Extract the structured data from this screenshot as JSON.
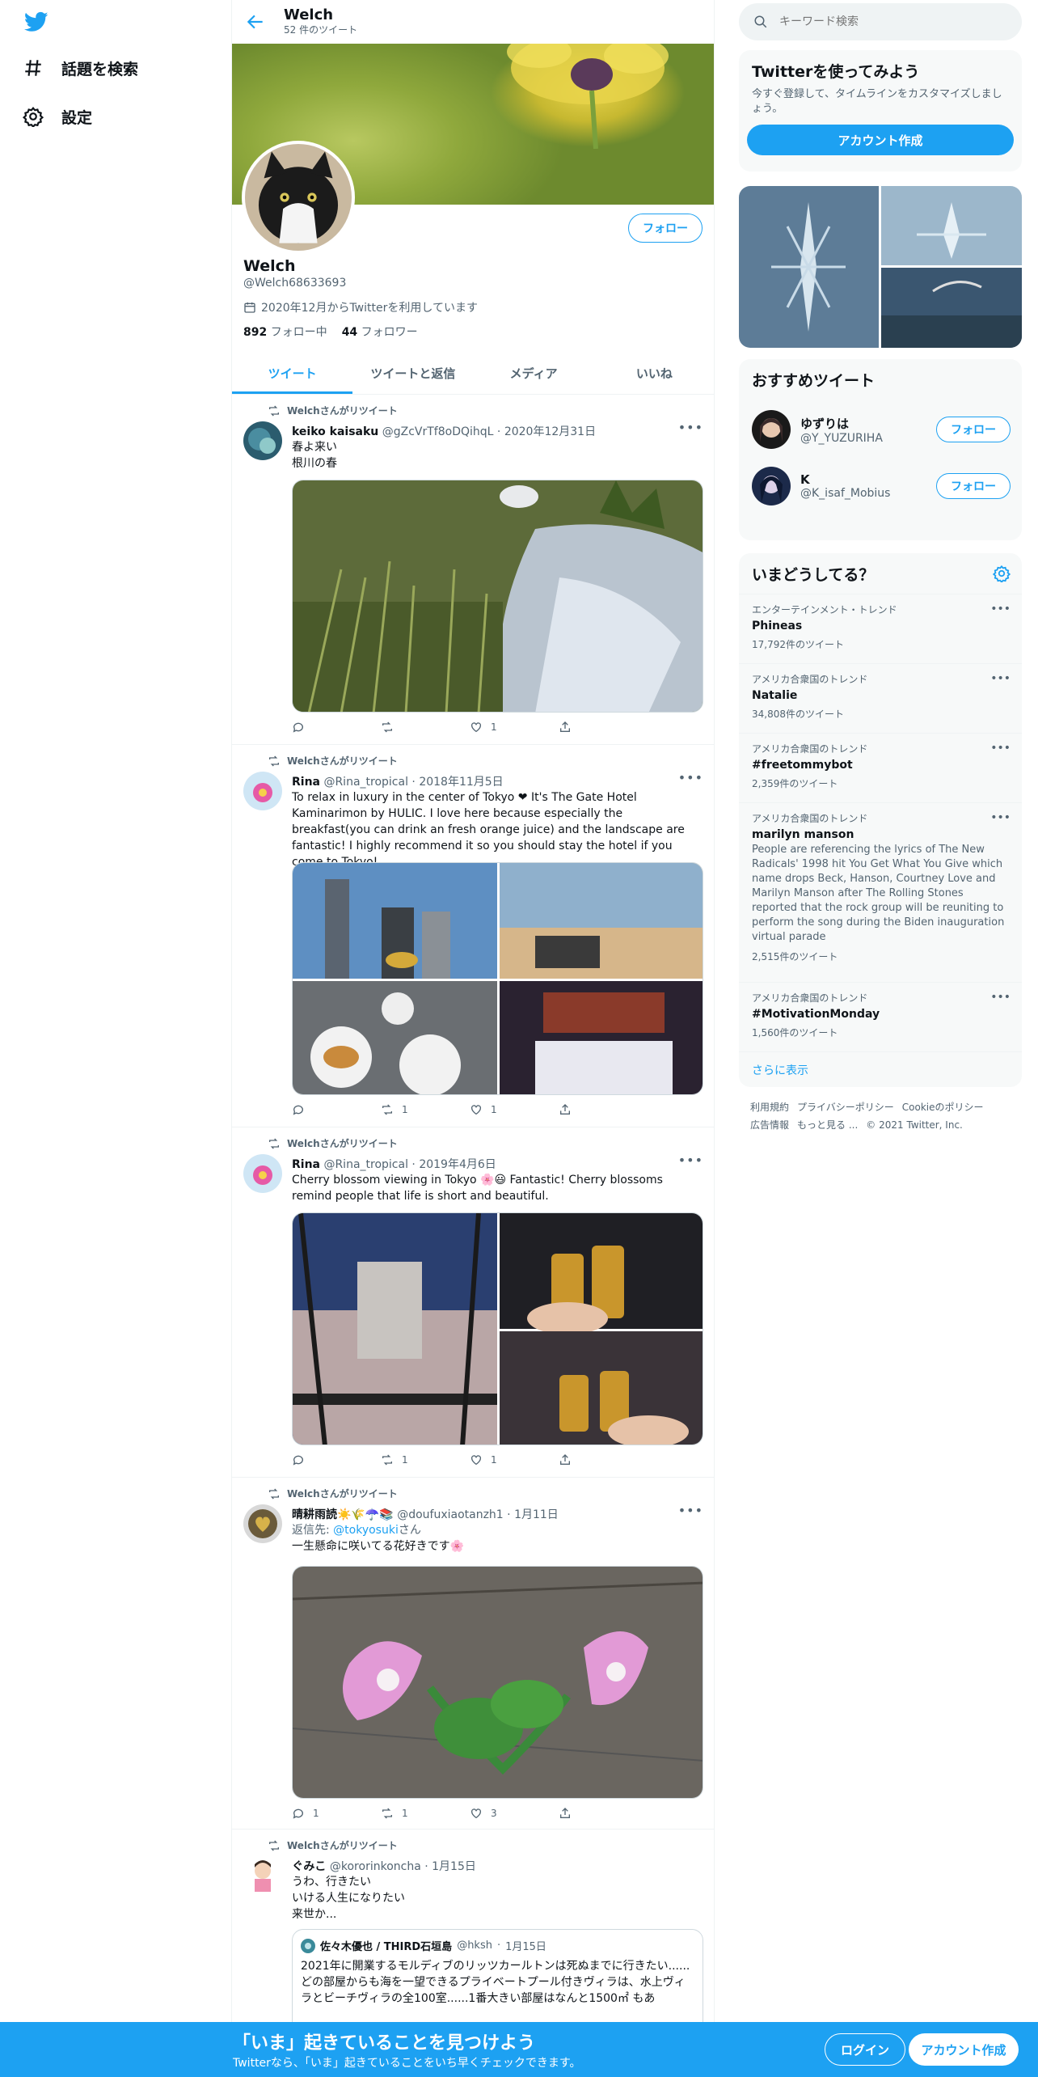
{
  "nav": {
    "explore": "話題を検索",
    "settings": "設定"
  },
  "header": {
    "title": "Welch",
    "tweet_count": "52 件のツイート"
  },
  "profile": {
    "name": "Welch",
    "handle": "@Welch68633693",
    "joined": "2020年12月からTwitterを利用しています",
    "following_num": "892",
    "following_label": "フォロー中",
    "followers_num": "44",
    "followers_label": "フォロワー",
    "follow_label": "フォロー"
  },
  "tabs": [
    "ツイート",
    "ツイートと返信",
    "メディア",
    "いいね"
  ],
  "retweet_label": "Welchさんがリツイート",
  "tweets": [
    {
      "name": "keiko kaisaku",
      "handle": "@gZcVrTf8oDQihqL",
      "date": "2020年12月31日",
      "text1": "春よ来い",
      "text2": "根川の春",
      "reply": "",
      "retweet": "",
      "like": "1"
    },
    {
      "name": "Rina",
      "handle": "@Rina_tropical",
      "date": "2018年11月5日",
      "text": "To relax in luxury in the center of Tokyo ❤ It's The Gate Hotel Kaminarimon by HULIC. I love here because especially the breakfast(you can drink an fresh orange juice) and the landscape are fantastic! I highly recommend it so you should stay the hotel if you come to Tokyo!",
      "reply": "",
      "retweet": "1",
      "like": "1"
    },
    {
      "name": "Rina",
      "handle": "@Rina_tropical",
      "date": "2019年4月6日",
      "text": "Cherry blossom viewing in Tokyo 🌸😃 Fantastic! Cherry blossoms remind people that life is short and beautiful.",
      "reply": "",
      "retweet": "1",
      "like": "1"
    },
    {
      "name": "晴耕雨読☀️🌾☂️📚",
      "handle": "@doufuxiaotanzh1",
      "date": "1月11日",
      "reply_to_label": "返信先:",
      "reply_to": "@tokyosuki",
      "reply_to_suffix": "さん",
      "text": "一生懸命に咲いてる花好きです🌸",
      "reply": "1",
      "retweet": "1",
      "like": "3"
    },
    {
      "name": "ぐみこ",
      "handle": "@kororinkoncha",
      "date": "1月15日",
      "text1": "うわ、行きたい",
      "text2": "いける人生になりたい",
      "text3": "来世か...",
      "quote": {
        "name": "佐々木優也 / THIRD石垣島",
        "handle": "@hksh",
        "date": "1月15日",
        "text1": "2021年に開業するモルディブのリッツカールトンは死ぬまでに行きたい......",
        "text2": "どの部屋からも海を一望できるプライベートプール付きヴィラは、水上ヴィラとビーチヴィラの全100室......1番大きい部屋はなんと1500㎡ もあ"
      }
    }
  ],
  "right": {
    "search_placeholder": "キーワード検索",
    "signup_box": {
      "title": "Twitterを使ってみよう",
      "desc": "今すぐ登録して、タイムラインをカスタマイズしましょう。",
      "button": "アカウント作成"
    },
    "recommend": {
      "title": "おすすめツイート",
      "users": [
        {
          "name": "ゆずりは",
          "handle": "@Y_YUZURIHA",
          "follow": "フォロー"
        },
        {
          "name": "K",
          "handle": "@K_isaf_Mobius",
          "follow": "フォロー"
        }
      ]
    },
    "trends": {
      "title": "いまどうしてる？",
      "items": [
        {
          "context": "エンターテインメント・トレンド",
          "name": "Phineas",
          "count": "17,792件のツイート"
        },
        {
          "context": "アメリカ合衆国のトレンド",
          "name": "Natalie",
          "count": "34,808件のツイート"
        },
        {
          "context": "アメリカ合衆国のトレンド",
          "name": "#freetommybot",
          "count": "2,359件のツイート"
        },
        {
          "context": "アメリカ合衆国のトレンド",
          "name": "marilyn manson",
          "desc": "People are referencing the lyrics of The New Radicals' 1998 hit You Get What You Give which name drops Beck, Hanson, Courtney Love and Marilyn Manson after The Rolling Stones reported that the rock group will be reuniting to perform the song during the Biden inauguration virtual parade",
          "count": "2,515件のツイート"
        },
        {
          "context": "アメリカ合衆国のトレンド",
          "name": "#MotivationMonday",
          "count": "1,560件のツイート"
        }
      ],
      "show_more": "さらに表示"
    },
    "footer": {
      "terms": "利用規約",
      "privacy": "プライバシーポリシー",
      "cookie": "Cookieのポリシー",
      "ads": "広告情報",
      "more": "もっと見る ...",
      "copyright": "© 2021 Twitter, Inc."
    }
  },
  "bottom": {
    "title": "「いま」起きていることを見つけよう",
    "subtitle": "Twitterなら、「いま」起きていることをいち早くチェックできます。",
    "login": "ログイン",
    "signup": "アカウント作成"
  },
  "colors": {
    "accent": "#1da1f2",
    "text": "#0f1419",
    "muted": "#536471"
  }
}
